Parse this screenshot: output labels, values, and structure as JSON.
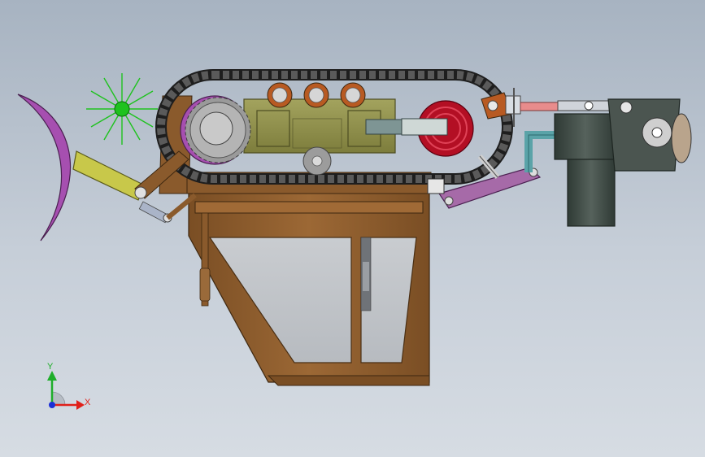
{
  "window": {
    "title": ""
  },
  "viewport": {
    "background_top": "#a7b3c1",
    "background_bottom": "#d6dce3"
  },
  "triad": {
    "x_label": "X",
    "y_label": "Y",
    "x_color": "#e0201a",
    "y_color": "#1fae2a",
    "z_color": "#1b2fd6"
  },
  "colors": {
    "frame": "#8a5a2c",
    "frame_dark": "#5a3a18",
    "track": "#2b2b2b",
    "purple": "#a64fb0",
    "yellow": "#c8c84a",
    "olive_box": "#8f8f4a",
    "red_pulley": "#c0122a",
    "green_wheel": "#1ec21e",
    "motor": "#3c4642",
    "pink_rod": "#e88c8c",
    "teal_pipe": "#5aa3a8"
  },
  "icons": [
    "axis-triad-icon"
  ]
}
